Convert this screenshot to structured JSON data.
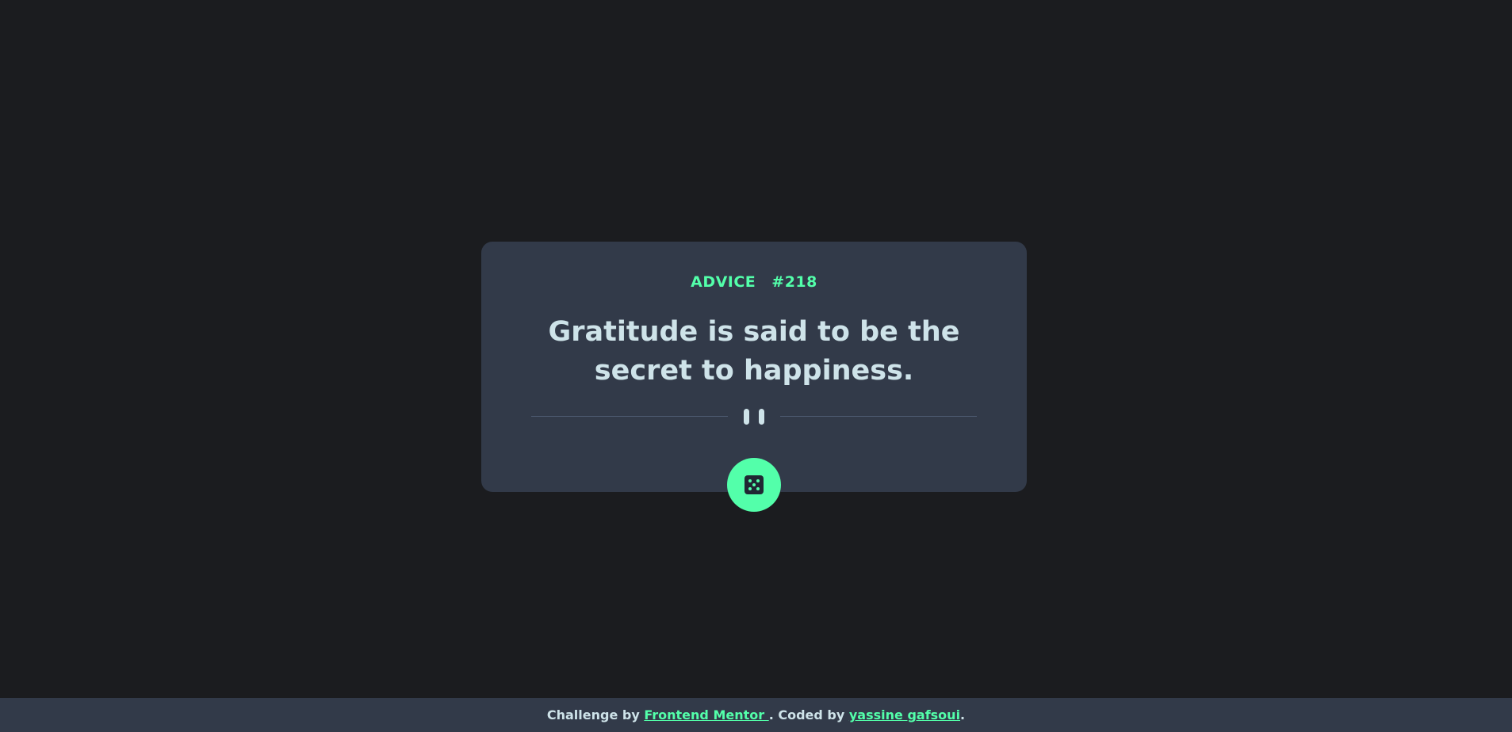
{
  "card": {
    "advice_label": "ADVICE",
    "advice_number": "#218",
    "quote": "Gratitude is said to be the secret to happiness."
  },
  "divider": {
    "icon": "pause-icon"
  },
  "dice_button": {
    "icon": "dice-icon"
  },
  "footer": {
    "prefix": "Challenge by ",
    "challenge_link": "Frontend Mentor ",
    "middle": ". Coded by ",
    "author_link": "yassine gafsoui",
    "suffix": "."
  },
  "colors": {
    "background": "#1b1c1f",
    "card": "#323a49",
    "accent": "#53ffaa",
    "text": "#cee3e9"
  }
}
